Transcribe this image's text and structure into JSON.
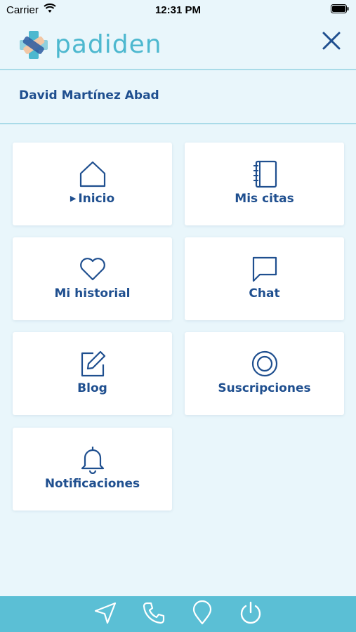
{
  "status_bar": {
    "carrier": "Carrier",
    "time": "12:31 PM"
  },
  "header": {
    "logo_text": "padiden"
  },
  "user": {
    "name": "David Martínez Abad"
  },
  "menu": {
    "items": [
      {
        "label": "Inicio",
        "icon": "home-icon",
        "active": true
      },
      {
        "label": "Mis citas",
        "icon": "notebook-icon",
        "active": false
      },
      {
        "label": "Mi historial",
        "icon": "heart-icon",
        "active": false
      },
      {
        "label": "Chat",
        "icon": "chat-bubble-icon",
        "active": false
      },
      {
        "label": "Blog",
        "icon": "edit-icon",
        "active": false
      },
      {
        "label": "Suscripciones",
        "icon": "disc-icon",
        "active": false
      },
      {
        "label": "Notificaciones",
        "icon": "bell-icon",
        "active": false
      }
    ]
  },
  "bottom_bar": {
    "icons": [
      "navigation-icon",
      "phone-icon",
      "location-pin-icon",
      "power-icon"
    ]
  },
  "colors": {
    "accent": "#1f4f8f",
    "brand": "#4db8cf",
    "background": "#e9f6fb",
    "bottom_bar": "#5bbfd5"
  }
}
